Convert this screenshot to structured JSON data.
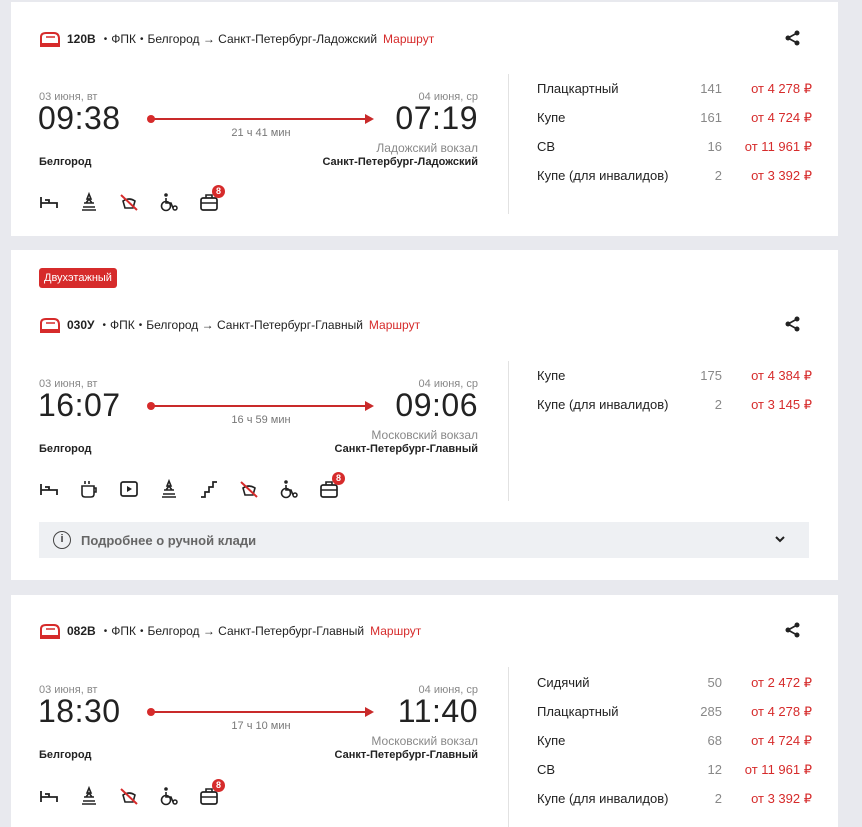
{
  "trains": [
    {
      "badge": "",
      "number": "120В",
      "carrier": "ФПК",
      "route": "Белгород → Санкт-Петербург-Ладожский",
      "route_link": "Маршрут",
      "dep_date": "03 июня, вт",
      "dep_time": "09:38",
      "arr_date": "04 июня, ср",
      "arr_time": "07:19",
      "duration": "21 ч 41 мин",
      "arr_station": "Ладожский вокзал",
      "from_city": "Белгород",
      "to_city": "Санкт-Петербург-Ладожский",
      "luggage_count": "8",
      "amenities": [
        "bed-icon",
        "star-service-icon",
        "no-pets-icon",
        "wheelchair-icon",
        "luggage-icon"
      ],
      "classes": [
        {
          "name": "Плацкартный",
          "seats": "141",
          "price": "от 4 278 ₽"
        },
        {
          "name": "Купе",
          "seats": "161",
          "price": "от 4 724 ₽"
        },
        {
          "name": "СВ",
          "seats": "16",
          "price": "от 11 961 ₽"
        },
        {
          "name": "Купе (для инвалидов)",
          "seats": "2",
          "price": "от 3 392 ₽"
        }
      ]
    },
    {
      "badge": "Двухэтажный",
      "number": "030У",
      "carrier": "ФПК",
      "route": "Белгород → Санкт-Петербург-Главный",
      "route_link": "Маршрут",
      "dep_date": "03 июня, вт",
      "dep_time": "16:07",
      "arr_date": "04 июня, ср",
      "arr_time": "09:06",
      "duration": "16 ч 59 мин",
      "arr_station": "Московский вокзал",
      "from_city": "Белгород",
      "to_city": "Санкт-Петербург-Главный",
      "luggage_count": "8",
      "amenities": [
        "bed-icon",
        "coffee-icon",
        "video-icon",
        "star-service-icon",
        "stairs-icon",
        "no-pets-icon",
        "wheelchair-icon",
        "luggage-icon"
      ],
      "info_bar": "Подробнее о ручной клади",
      "classes": [
        {
          "name": "Купе",
          "seats": "175",
          "price": "от 4 384 ₽"
        },
        {
          "name": "Купе (для инвалидов)",
          "seats": "2",
          "price": "от 3 145 ₽"
        }
      ]
    },
    {
      "badge": "",
      "number": "082В",
      "carrier": "ФПК",
      "route": "Белгород → Санкт-Петербург-Главный",
      "route_link": "Маршрут",
      "dep_date": "03 июня, вт",
      "dep_time": "18:30",
      "arr_date": "04 июня, ср",
      "arr_time": "11:40",
      "duration": "17 ч 10 мин",
      "arr_station": "Московский вокзал",
      "from_city": "Белгород",
      "to_city": "Санкт-Петербург-Главный",
      "luggage_count": "8",
      "amenities": [
        "bed-icon",
        "star-service-icon",
        "no-pets-icon",
        "wheelchair-icon",
        "luggage-icon"
      ],
      "classes": [
        {
          "name": "Сидячий",
          "seats": "50",
          "price": "от 2 472 ₽"
        },
        {
          "name": "Плацкартный",
          "seats": "285",
          "price": "от 4 278 ₽"
        },
        {
          "name": "Купе",
          "seats": "68",
          "price": "от 4 724 ₽"
        },
        {
          "name": "СВ",
          "seats": "12",
          "price": "от 11 961 ₽"
        },
        {
          "name": "Купе (для инвалидов)",
          "seats": "2",
          "price": "от 3 392 ₽"
        }
      ]
    }
  ]
}
